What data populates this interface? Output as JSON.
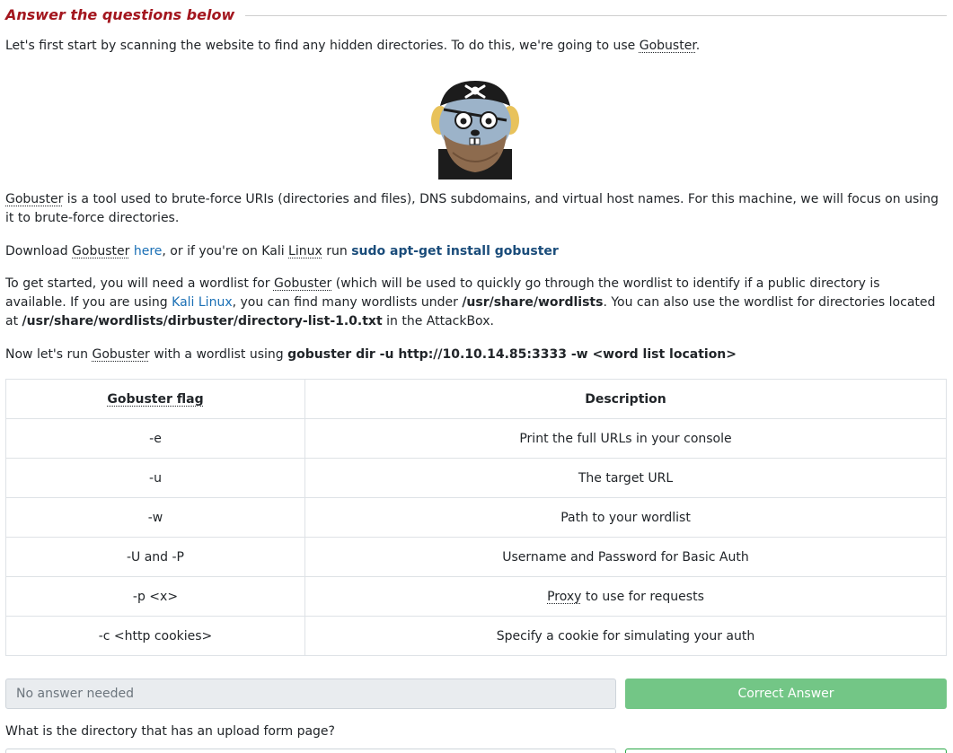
{
  "section": {
    "title": "Answer the questions below"
  },
  "intro": {
    "text_before": "Let's first start by scanning the website to find any hidden directories. To do this, we're going to use ",
    "tool": "Gobuster",
    "text_after": "."
  },
  "mascot": {
    "icon": "gobuster-pirate-gopher-icon"
  },
  "description": {
    "tool": "Gobuster",
    "text": " is a tool used to brute-force URIs (directories and files), DNS subdomains, and virtual host names. For this machine, we will focus on using it to brute-force directories."
  },
  "download": {
    "prefix": "Download ",
    "tool": "Gobuster",
    "space": " ",
    "here_link": "here",
    "middle": ", or if you're on Kali ",
    "linux": "Linux",
    "run": " run ",
    "command": "sudo apt-get install gobuster"
  },
  "wordlist": {
    "p1": "To get started, you will need a wordlist for ",
    "tool": "Gobuster",
    "p2": " (which will be used to quickly go through the wordlist to identify if a public directory is available. If you are using ",
    "kali_link": "Kali Linux",
    "p3": ", you can find many wordlists under ",
    "path1": "/usr/share/wordlists",
    "p4": ". You can also use the wordlist for directories located at ",
    "path2": "/usr/share/wordlists/dirbuster/directory-list-1.0.txt",
    "p5": " in the AttackBox."
  },
  "run": {
    "p1": "Now let's run ",
    "tool": "Gobuster",
    "p2": " with a wordlist using ",
    "command": "gobuster dir -u http://10.10.14.85:3333 -w <word list location>"
  },
  "table": {
    "headers": [
      "Gobuster flag",
      "Description"
    ],
    "rows": [
      {
        "flag": "-e",
        "desc": "Print the full URLs in your console"
      },
      {
        "flag": "-u",
        "desc": "The target URL"
      },
      {
        "flag": "-w",
        "desc": "Path to your wordlist"
      },
      {
        "flag": "-U and -P",
        "desc": "Username and Password for Basic Auth"
      },
      {
        "flag": "-p <x>",
        "desc_link": "Proxy",
        "desc_rest": " to use for requests"
      },
      {
        "flag": "-c <http cookies>",
        "desc": "Specify a cookie for simulating your auth"
      }
    ]
  },
  "answer1": {
    "placeholder": "No answer needed",
    "button": "Correct Answer",
    "button_color": "#73c686"
  },
  "question2": {
    "text": "What is the directory that has an upload form page?"
  }
}
